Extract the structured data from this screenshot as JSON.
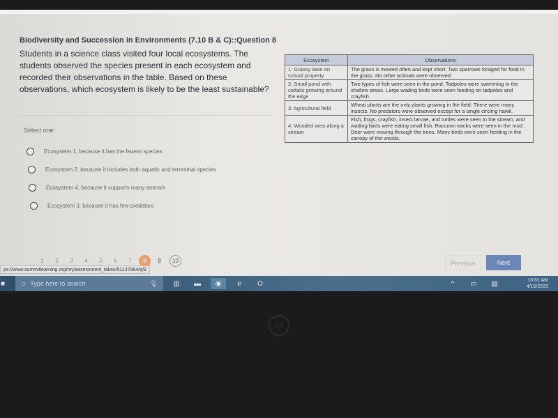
{
  "question": {
    "title": "Biodiversity and Succession in Environments (7.10 B & C)::Question 8",
    "text": "Students in a science class visited four local ecosystems. The students observed the species present in each ecosystem and recorded their observations in the table. Based on these observations, which ecosystem is likely to be the least sustainable?",
    "select_label": "Select one:",
    "options": [
      "Ecosystem 1, because it has the fewest species",
      "Ecosystem 2, because it includes both aquatic and terrestrial species",
      "Ecosystem 4, because it supports many animals",
      "Ecosystem 3, because it has few predators"
    ]
  },
  "table": {
    "headers": [
      "Ecosystem",
      "Observations"
    ],
    "rows": [
      [
        "1: Grassy lawn on school property",
        "The grass is mowed often and kept short. Two sparrows foraged for food in the grass. No other animals were observed."
      ],
      [
        "2: Small pond with cattails growing around the edge",
        "Two types of fish were seen in the pond. Tadpoles were swimming in the shallow areas. Large wading birds were seen feeding on tadpoles and crayfish."
      ],
      [
        "3: Agricultural field",
        "Wheat plants are the only plants growing in the field. There were many insects. No predators were observed except for a single circling hawk."
      ],
      [
        "4: Wooded area along a stream",
        "Fish, frogs, crayfish, insect larvae, and turtles were seen in the stream, and wading birds were eating small fish. Raccoon tracks were seen in the mud. Deer were moving through the trees. Many birds were seen feeding in the canopy of the woods."
      ]
    ]
  },
  "pager": {
    "pages": [
      "1",
      "2",
      "3",
      "4",
      "5",
      "6",
      "7",
      "8",
      "9",
      "10"
    ],
    "current": "8",
    "previous": "Previous",
    "next": "Next"
  },
  "status_url": "ps://www.summitlearning.org/my/assessment_takes/51137864/q/9",
  "taskbar": {
    "search_placeholder": "Type here to search",
    "time": "10:51 AM",
    "date": "4/16/2020"
  },
  "colors": {
    "accent": "#6b87b6",
    "current_page": "#e79e6b",
    "taskbar": "#3f6382"
  }
}
